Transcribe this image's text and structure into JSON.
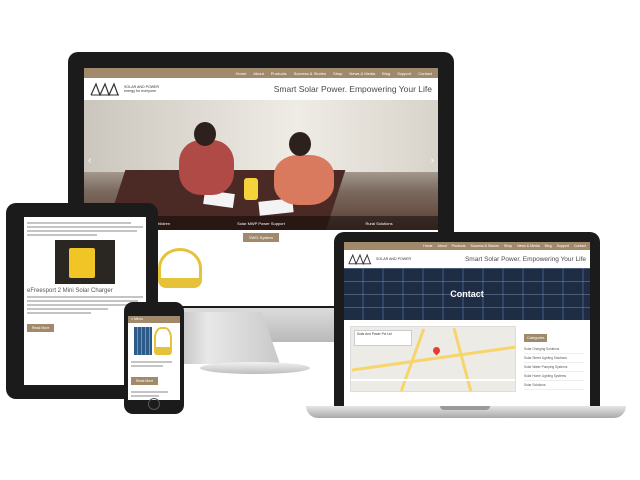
{
  "brand": {
    "logo_text_line1": "SOLAR AND POWER",
    "logo_text_line2": "energy for everyone",
    "accent_color": "#a08a6b"
  },
  "nav": {
    "items": [
      "Home",
      "About",
      "Products",
      "Success & Stories",
      "Shop",
      "News & Media",
      "Blog",
      "Support",
      "Contact"
    ]
  },
  "desktop": {
    "tagline": "Smart Solar Power. Empowering Your Life",
    "hero_captions": [
      "Solar Study Lights for Children",
      "Solar MWP Power Support",
      "Rural Solutions"
    ],
    "section_button": "SWG System"
  },
  "tablet": {
    "product_title": "eFreesport 2 Mini Solar Charger",
    "read_more": "Read More"
  },
  "phone": {
    "menu_label": "≡ Menu",
    "button": "Read More"
  },
  "laptop": {
    "tagline": "Smart Solar Power. Empowering Your Life",
    "banner_title": "Contact",
    "map_card": "Solar And Power Pvt Ltd",
    "sidebar_heading": "Categories",
    "sidebar_items": [
      "Solar Charging Solutions",
      "Solar Street Lighting Solutions",
      "Solar Water Pumping Systems",
      "Solar Home Lighting Systems",
      "Solar Solutions"
    ]
  }
}
